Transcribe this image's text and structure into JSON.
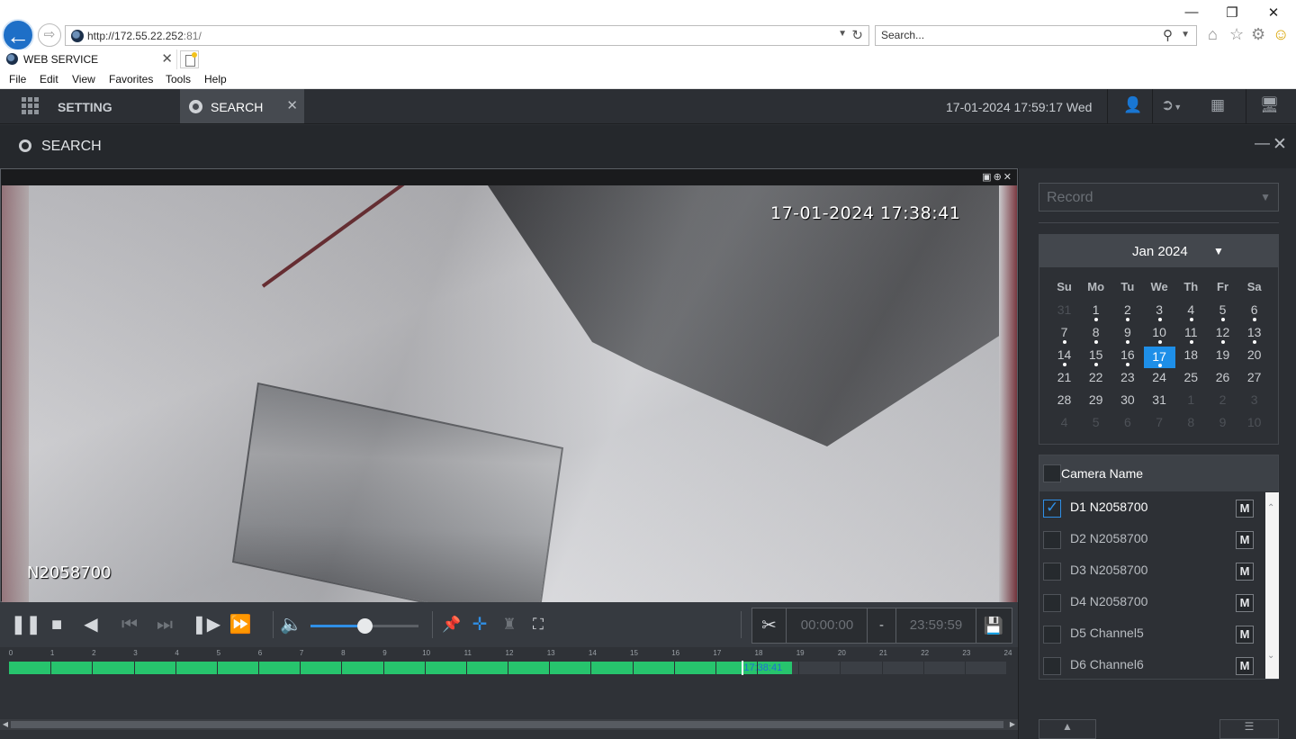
{
  "browser": {
    "url_host": "http://172.55.22.252",
    "url_port": ":81/",
    "search_placeholder": "Search...",
    "tab_title": "WEB SERVICE",
    "menu": [
      "File",
      "Edit",
      "View",
      "Favorites",
      "Tools",
      "Help"
    ]
  },
  "app_header": {
    "setting_label": "SETTING",
    "active_tab": "SEARCH",
    "datetime": "17-01-2024 17:59:17 Wed"
  },
  "titlebar": {
    "title": "SEARCH"
  },
  "video": {
    "osd_timestamp": "17-01-2024 17:38:41",
    "osd_channel": "N2058700"
  },
  "playback": {
    "volume": 0.5,
    "clip_start": "00:00:00",
    "clip_sep": "-",
    "clip_end": "23:59:59"
  },
  "timeline": {
    "hours": [
      "0",
      "1",
      "2",
      "3",
      "4",
      "5",
      "6",
      "7",
      "8",
      "9",
      "10",
      "11",
      "12",
      "13",
      "14",
      "15",
      "16",
      "17",
      "18",
      "19",
      "20",
      "21",
      "22",
      "23",
      "24"
    ],
    "recorded_until_hour": 18.85,
    "cursor_hour": 17.64,
    "cursor_label": "17:38:41"
  },
  "record_type": {
    "value": "Record"
  },
  "calendar": {
    "month_label": "Jan 2024",
    "weekdays": [
      "Su",
      "Mo",
      "Tu",
      "We",
      "Th",
      "Fr",
      "Sa"
    ],
    "weeks": [
      [
        {
          "d": "31",
          "o": true
        },
        {
          "d": "1",
          "r": true
        },
        {
          "d": "2",
          "r": true
        },
        {
          "d": "3",
          "r": true
        },
        {
          "d": "4",
          "r": true
        },
        {
          "d": "5",
          "r": true
        },
        {
          "d": "6",
          "r": true
        }
      ],
      [
        {
          "d": "7",
          "r": true
        },
        {
          "d": "8",
          "r": true
        },
        {
          "d": "9",
          "r": true
        },
        {
          "d": "10",
          "r": true
        },
        {
          "d": "11",
          "r": true
        },
        {
          "d": "12",
          "r": true
        },
        {
          "d": "13",
          "r": true
        }
      ],
      [
        {
          "d": "14",
          "r": true
        },
        {
          "d": "15",
          "r": true
        },
        {
          "d": "16",
          "r": true
        },
        {
          "d": "17",
          "r": true,
          "s": true
        },
        {
          "d": "18"
        },
        {
          "d": "19"
        },
        {
          "d": "20"
        }
      ],
      [
        {
          "d": "21"
        },
        {
          "d": "22"
        },
        {
          "d": "23"
        },
        {
          "d": "24"
        },
        {
          "d": "25"
        },
        {
          "d": "26"
        },
        {
          "d": "27"
        }
      ],
      [
        {
          "d": "28"
        },
        {
          "d": "29"
        },
        {
          "d": "30"
        },
        {
          "d": "31"
        },
        {
          "d": "1",
          "o": true
        },
        {
          "d": "2",
          "o": true
        },
        {
          "d": "3",
          "o": true
        }
      ],
      [
        {
          "d": "4",
          "o": true
        },
        {
          "d": "5",
          "o": true
        },
        {
          "d": "6",
          "o": true
        },
        {
          "d": "7",
          "o": true
        },
        {
          "d": "8",
          "o": true
        },
        {
          "d": "9",
          "o": true
        },
        {
          "d": "10",
          "o": true
        }
      ]
    ]
  },
  "cameras": {
    "header": "Camera Name",
    "items": [
      {
        "name": "D1 N2058700",
        "checked": true,
        "m": "M"
      },
      {
        "name": "D2 N2058700",
        "checked": false,
        "m": "M"
      },
      {
        "name": "D3 N2058700",
        "checked": false,
        "m": "M"
      },
      {
        "name": "D4 N2058700",
        "checked": false,
        "m": "M"
      },
      {
        "name": "D5 Channel5",
        "checked": false,
        "m": "M"
      },
      {
        "name": "D6 Channel6",
        "checked": false,
        "m": "M"
      }
    ]
  },
  "colors": {
    "accent": "#1e8fe8",
    "record": "#27c46d",
    "header_bg": "#2c2f34"
  }
}
